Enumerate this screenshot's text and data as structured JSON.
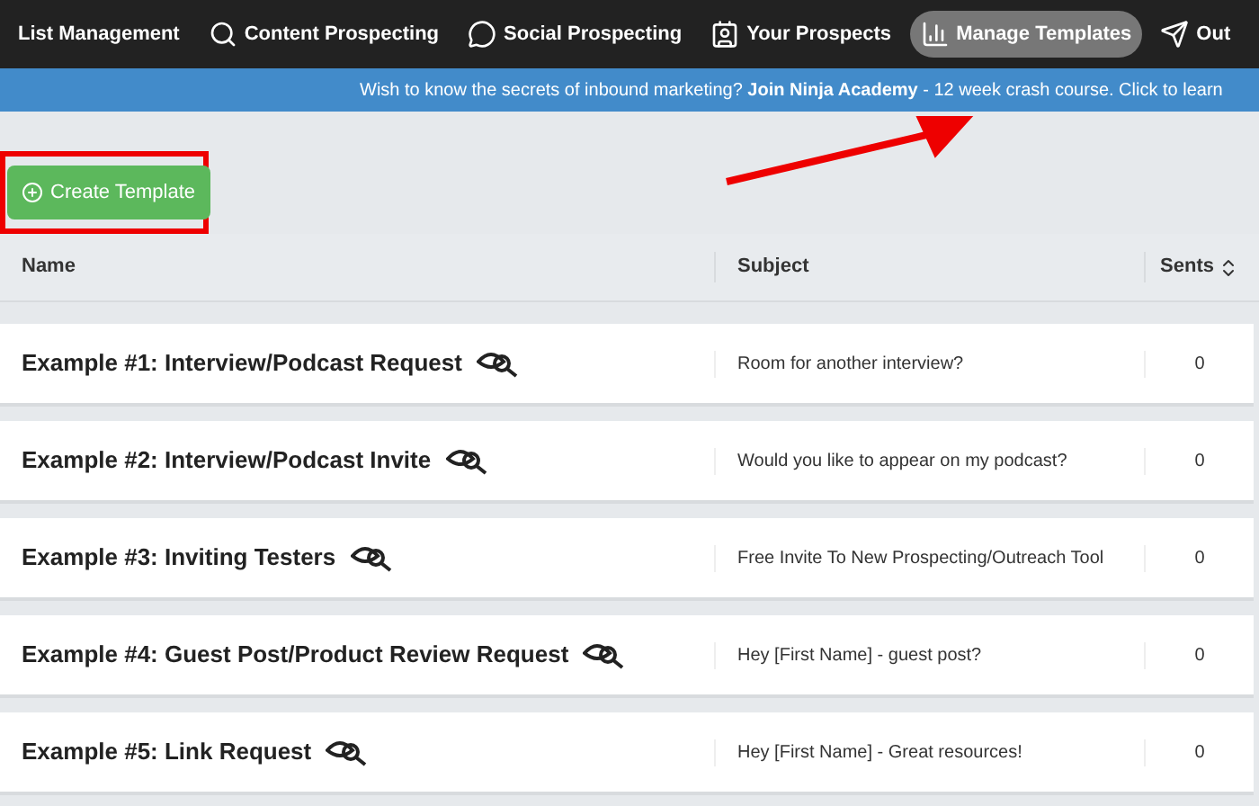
{
  "nav": {
    "items": [
      {
        "label": "List Management",
        "selected": false
      },
      {
        "label": "Content Prospecting",
        "selected": false
      },
      {
        "label": "Social Prospecting",
        "selected": false
      },
      {
        "label": "Your Prospects",
        "selected": false
      },
      {
        "label": "Manage Templates",
        "selected": true
      },
      {
        "label": "Out",
        "selected": false
      }
    ]
  },
  "banner": {
    "text": "Wish to know the secrets of inbound marketing? **Join Ninja Academy** - 12 week crash course. Click to learn"
  },
  "create_button": {
    "label": "Create Template"
  },
  "table": {
    "columns": [
      "Name",
      "Subject",
      "Sents"
    ],
    "rows": [
      {
        "name": "Example #1: Interview/Podcast Request",
        "subject": "Room for another interview?",
        "sents": "0"
      },
      {
        "name": "Example #2: Interview/Podcast Invite",
        "subject": "Would you like to appear on my podcast?",
        "sents": "0"
      },
      {
        "name": "Example #3: Inviting Testers",
        "subject": "Free Invite To New Prospecting/Outreach Tool",
        "sents": "0"
      },
      {
        "name": "Example #4: Guest Post/Product Review Request",
        "subject": "Hey [First Name] - guest post?",
        "sents": "0"
      },
      {
        "name": "Example #5: Link Request",
        "subject": "Hey [First Name] - Great resources!",
        "sents": "0"
      }
    ]
  }
}
